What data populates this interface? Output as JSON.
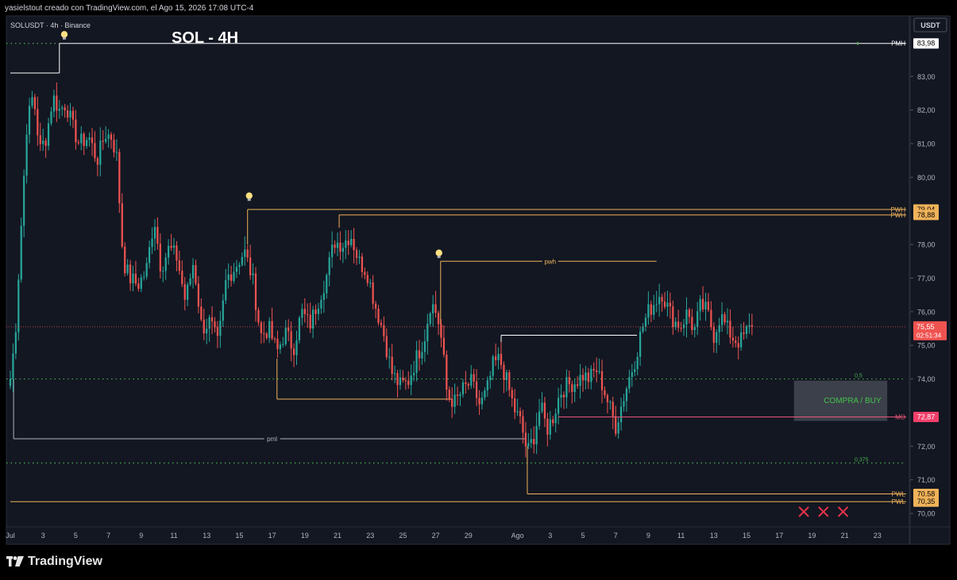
{
  "header": {
    "credit": "yasielstout creado con TradingView.com, el Ago 15, 2026 17:08 UTC-4"
  },
  "brand": {
    "name": "TradingView"
  },
  "chart_data": {
    "type": "candlestick",
    "symbol_line": "SOLUSDT · 4h · Binance",
    "title": "SOL - 4H",
    "currency_button": "USDT",
    "ylim": [
      69.6,
      84.8
    ],
    "y_ticks": [
      {
        "v": 83.0,
        "t": "83,00"
      },
      {
        "v": 82.0,
        "t": "82,00"
      },
      {
        "v": 81.0,
        "t": "81,00"
      },
      {
        "v": 80.0,
        "t": "80,00"
      },
      {
        "v": 78.0,
        "t": "78,00"
      },
      {
        "v": 77.0,
        "t": "77,00"
      },
      {
        "v": 76.0,
        "t": "76,00"
      },
      {
        "v": 75.0,
        "t": "75,00"
      },
      {
        "v": 74.0,
        "t": "74,00"
      },
      {
        "v": 72.0,
        "t": "72,00"
      },
      {
        "v": 71.0,
        "t": "71,00"
      },
      {
        "v": 70.0,
        "t": "70,00"
      }
    ],
    "x_days": [
      1,
      47
    ],
    "x_ticks": [
      {
        "d": 1,
        "t": "Jul"
      },
      {
        "d": 3,
        "t": "3"
      },
      {
        "d": 5,
        "t": "5"
      },
      {
        "d": 7,
        "t": "7"
      },
      {
        "d": 9,
        "t": "9"
      },
      {
        "d": 11,
        "t": "11"
      },
      {
        "d": 13,
        "t": "13"
      },
      {
        "d": 15,
        "t": "15"
      },
      {
        "d": 17,
        "t": "17"
      },
      {
        "d": 19,
        "t": "19"
      },
      {
        "d": 21,
        "t": "21"
      },
      {
        "d": 23,
        "t": "23"
      },
      {
        "d": 25,
        "t": "25"
      },
      {
        "d": 27,
        "t": "27"
      },
      {
        "d": 29,
        "t": "29"
      },
      {
        "d": 32,
        "t": "Ago"
      },
      {
        "d": 34,
        "t": "3"
      },
      {
        "d": 36,
        "t": "5"
      },
      {
        "d": 38,
        "t": "7"
      },
      {
        "d": 40,
        "t": "9"
      },
      {
        "d": 42,
        "t": "11"
      },
      {
        "d": 44,
        "t": "13"
      },
      {
        "d": 46,
        "t": "15"
      },
      {
        "d": 48,
        "t": "17"
      },
      {
        "d": 50,
        "t": "19"
      },
      {
        "d": 52,
        "t": "21"
      },
      {
        "d": 54,
        "t": "23"
      }
    ],
    "levels": [
      {
        "name": "PMH",
        "value": 83.98,
        "label": "PMH",
        "price": "83,98",
        "color": "#ffffff",
        "style": "solid",
        "x0": 4.0,
        "x1": 54.5,
        "label_color": "#ffffff",
        "tag_bg": "#ffffff",
        "tag_fg": "#000000"
      },
      {
        "name": "PWH1",
        "value": 79.04,
        "label": "PWH",
        "price": "79,04",
        "color": "#f0b35a",
        "style": "solid",
        "x0": 15.5,
        "x1": 54.5,
        "label_color": "#f0b35a",
        "tag_bg": "#f0b35a",
        "tag_fg": "#000000"
      },
      {
        "name": "PWH2",
        "value": 78.88,
        "label": "PWH",
        "price": "78,88",
        "color": "#f0b35a",
        "style": "solid",
        "x0": 21.1,
        "x1": 54.5,
        "label_color": "#f0b35a",
        "tag_bg": "#f0b35a",
        "tag_fg": "#000000"
      },
      {
        "name": "MO",
        "value": 72.87,
        "label": "MO",
        "price": "72,87",
        "color": "#e8557a",
        "style": "solid",
        "x0": 34.5,
        "x1": 54.5,
        "label_color": "#e8557a",
        "tag_bg": "#f23f6a",
        "tag_fg": "#ffffff"
      },
      {
        "name": "PWL1",
        "value": 70.58,
        "label": "PWL",
        "price": "70,58",
        "color": "#f0b35a",
        "style": "solid",
        "x0": 32.6,
        "x1": 54.5,
        "label_color": "#f0b35a",
        "tag_bg": "#f0b35a",
        "tag_fg": "#000000"
      },
      {
        "name": "PWL2",
        "value": 70.35,
        "label": "PWL",
        "price": "70,35",
        "color": "#f0b35a",
        "style": "solid",
        "x0": 1.0,
        "x1": 54.5,
        "label_color": "#f0b35a",
        "tag_bg": "#f0b35a",
        "tag_fg": "#000000"
      }
    ],
    "fib_levels": [
      {
        "value": 74.0,
        "label": "0,5"
      },
      {
        "value": 71.5,
        "label": "0,375"
      }
    ],
    "current": {
      "value": 75.55,
      "price": "75,55",
      "countdown": "02:51:34"
    },
    "segments": [
      {
        "x0": 1.0,
        "x1": 4.0,
        "v": 83.1,
        "color": "#ffffff"
      },
      {
        "x0": 1.2,
        "x1": 32.5,
        "v": 72.22,
        "color": "#b2b5be",
        "label": "pml",
        "label_x": 17
      },
      {
        "x0": 17.3,
        "x1": 28.0,
        "v": 73.4,
        "color": "#f0b35a"
      },
      {
        "x0": 27.3,
        "x1": 40.5,
        "v": 75.5,
        "color": "#f0b35a",
        "label": "pwh",
        "label_x": 34,
        "yv": 77.5
      },
      {
        "x0": 31.0,
        "x1": 39.3,
        "v": 75.3,
        "color": "#ffffff"
      }
    ],
    "verticals": [
      {
        "x": 1.2,
        "v0": 72.22,
        "v1": 74.0,
        "color": "#b2b5be"
      },
      {
        "x": 4.0,
        "v0": 83.1,
        "v1": 83.98,
        "color": "#ffffff"
      },
      {
        "x": 15.5,
        "v0": 78.0,
        "v1": 79.04,
        "color": "#f0b35a"
      },
      {
        "x": 21.1,
        "v0": 78.5,
        "v1": 78.88,
        "color": "#f0b35a"
      },
      {
        "x": 17.3,
        "v0": 73.4,
        "v1": 74.6,
        "color": "#f0b35a"
      },
      {
        "x": 27.3,
        "v0": 75.3,
        "v1": 77.5,
        "color": "#f0b35a"
      },
      {
        "x": 32.6,
        "v0": 70.58,
        "v1": 72.0,
        "color": "#f0b35a"
      },
      {
        "x": 31.0,
        "v0": 74.6,
        "v1": 75.3,
        "color": "#ffffff"
      }
    ],
    "pwh_top": {
      "x0": 27.3,
      "x1": 40.5,
      "v": 77.5
    },
    "ideas": [
      {
        "d": 4.3,
        "v": 84.25
      },
      {
        "d": 15.6,
        "v": 79.45
      },
      {
        "d": 27.2,
        "v": 77.75
      }
    ],
    "buy_zone": {
      "d0": 48.9,
      "d1": 54.6,
      "v0": 72.75,
      "v1": 73.95,
      "label": "COMPRA / BUY",
      "color": "#41c34a"
    },
    "crosses": [
      {
        "d": 49.5,
        "v": 70.05
      },
      {
        "d": 50.7,
        "v": 70.05
      },
      {
        "d": 51.9,
        "v": 70.05
      }
    ],
    "up_color": "#26a69a",
    "down_color": "#ef5350",
    "anchors": [
      [
        1.0,
        74.0
      ],
      [
        1.3,
        75.3
      ],
      [
        1.6,
        78.0
      ],
      [
        2.0,
        81.5
      ],
      [
        2.4,
        82.5
      ],
      [
        2.8,
        80.8
      ],
      [
        3.2,
        81.2
      ],
      [
        3.6,
        82.4
      ],
      [
        4.0,
        82.0
      ],
      [
        4.4,
        82.2
      ],
      [
        4.8,
        81.5
      ],
      [
        5.2,
        81.0
      ],
      [
        5.8,
        81.2
      ],
      [
        6.3,
        80.5
      ],
      [
        6.8,
        81.3
      ],
      [
        7.2,
        81.2
      ],
      [
        7.5,
        80.6
      ],
      [
        7.9,
        77.5
      ],
      [
        8.3,
        77.0
      ],
      [
        8.8,
        76.8
      ],
      [
        9.3,
        77.2
      ],
      [
        9.8,
        78.8
      ],
      [
        10.2,
        77.3
      ],
      [
        10.7,
        77.9
      ],
      [
        11.2,
        77.6
      ],
      [
        11.7,
        76.3
      ],
      [
        12.2,
        77.5
      ],
      [
        12.7,
        75.5
      ],
      [
        13.2,
        75.7
      ],
      [
        13.7,
        75.0
      ],
      [
        14.2,
        77.0
      ],
      [
        14.7,
        77.3
      ],
      [
        15.3,
        77.8
      ],
      [
        15.8,
        77.0
      ],
      [
        16.3,
        75.3
      ],
      [
        16.8,
        75.5
      ],
      [
        17.3,
        74.8
      ],
      [
        17.8,
        75.4
      ],
      [
        18.3,
        74.9
      ],
      [
        18.8,
        76.0
      ],
      [
        19.3,
        75.6
      ],
      [
        19.8,
        76.3
      ],
      [
        20.3,
        77.0
      ],
      [
        20.8,
        78.1
      ],
      [
        21.3,
        78.0
      ],
      [
        21.8,
        78.3
      ],
      [
        22.3,
        77.5
      ],
      [
        22.8,
        77.2
      ],
      [
        23.3,
        76.2
      ],
      [
        23.8,
        75.4
      ],
      [
        24.3,
        74.2
      ],
      [
        24.8,
        73.8
      ],
      [
        25.3,
        73.9
      ],
      [
        25.8,
        74.6
      ],
      [
        26.3,
        75.2
      ],
      [
        26.7,
        76.3
      ],
      [
        27.1,
        75.9
      ],
      [
        27.4,
        75.0
      ],
      [
        27.7,
        73.5
      ],
      [
        28.2,
        73.3
      ],
      [
        28.7,
        73.7
      ],
      [
        29.2,
        73.9
      ],
      [
        29.7,
        73.2
      ],
      [
        30.1,
        73.6
      ],
      [
        30.5,
        74.4
      ],
      [
        30.9,
        74.6
      ],
      [
        31.3,
        74.0
      ],
      [
        31.8,
        73.1
      ],
      [
        32.2,
        72.7
      ],
      [
        32.6,
        71.8
      ],
      [
        33.0,
        72.3
      ],
      [
        33.4,
        73.2
      ],
      [
        33.8,
        72.5
      ],
      [
        34.2,
        72.9
      ],
      [
        34.6,
        73.6
      ],
      [
        35.0,
        73.8
      ],
      [
        35.5,
        73.9
      ],
      [
        36.0,
        74.1
      ],
      [
        36.4,
        74.0
      ],
      [
        36.8,
        74.3
      ],
      [
        37.2,
        73.8
      ],
      [
        37.6,
        73.2
      ],
      [
        38.0,
        72.6
      ],
      [
        38.4,
        73.3
      ],
      [
        38.8,
        74.0
      ],
      [
        39.2,
        74.6
      ],
      [
        39.6,
        75.5
      ],
      [
        40.0,
        76.0
      ],
      [
        40.4,
        76.3
      ],
      [
        40.8,
        76.6
      ],
      [
        41.2,
        76.1
      ],
      [
        41.6,
        75.7
      ],
      [
        42.0,
        75.6
      ],
      [
        42.4,
        76.0
      ],
      [
        42.8,
        75.4
      ],
      [
        43.2,
        76.2
      ],
      [
        43.6,
        76.0
      ],
      [
        44.0,
        75.3
      ],
      [
        44.4,
        75.9
      ],
      [
        44.8,
        75.5
      ],
      [
        45.2,
        75.2
      ],
      [
        45.6,
        75.1
      ],
      [
        46.0,
        75.4
      ],
      [
        46.3,
        75.55
      ]
    ]
  }
}
